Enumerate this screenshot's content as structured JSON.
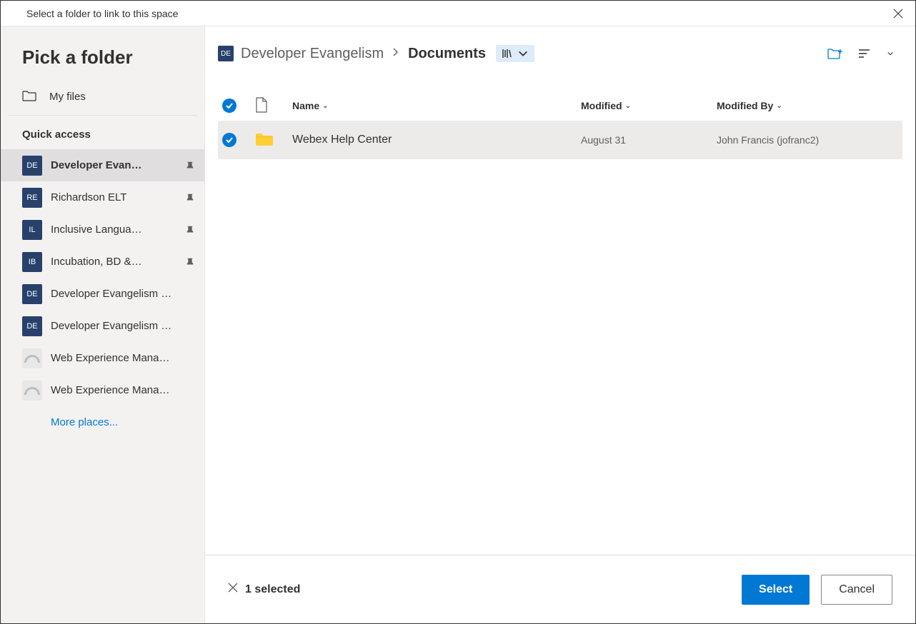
{
  "dialog": {
    "title": "Select a folder to link to this space"
  },
  "sidebar": {
    "heading": "Pick a folder",
    "my_files": "My files",
    "quick_access_label": "Quick access",
    "items": [
      {
        "badge": "DE",
        "label": "Developer Evan…",
        "pinned": true,
        "active": true,
        "badgeType": "dark"
      },
      {
        "badge": "RE",
        "label": "Richardson ELT",
        "pinned": true,
        "active": false,
        "badgeType": "dark"
      },
      {
        "badge": "IL",
        "label": "Inclusive Langua…",
        "pinned": true,
        "active": false,
        "badgeType": "dark"
      },
      {
        "badge": "IB",
        "label": "Incubation, BD &…",
        "pinned": true,
        "active": false,
        "badgeType": "dark"
      },
      {
        "badge": "DE",
        "label": "Developer Evangelism …",
        "pinned": false,
        "active": false,
        "badgeType": "dark"
      },
      {
        "badge": "DE",
        "label": "Developer Evangelism …",
        "pinned": false,
        "active": false,
        "badgeType": "dark"
      },
      {
        "badge": "",
        "label": "Web Experience Mana…",
        "pinned": false,
        "active": false,
        "badgeType": "gauge"
      },
      {
        "badge": "",
        "label": "Web Experience Mana…",
        "pinned": false,
        "active": false,
        "badgeType": "gauge"
      }
    ],
    "more_places": "More places..."
  },
  "breadcrumb": {
    "badge": "DE",
    "parent": "Developer Evangelism",
    "current": "Documents"
  },
  "columns": {
    "name": "Name",
    "modified": "Modified",
    "modified_by": "Modified By"
  },
  "rows": [
    {
      "name": "Webex Help Center",
      "modified": "August 31",
      "modified_by": "John Francis (jofranc2)",
      "selected": true
    }
  ],
  "footer": {
    "selection_text": "1 selected",
    "select_label": "Select",
    "cancel_label": "Cancel"
  }
}
